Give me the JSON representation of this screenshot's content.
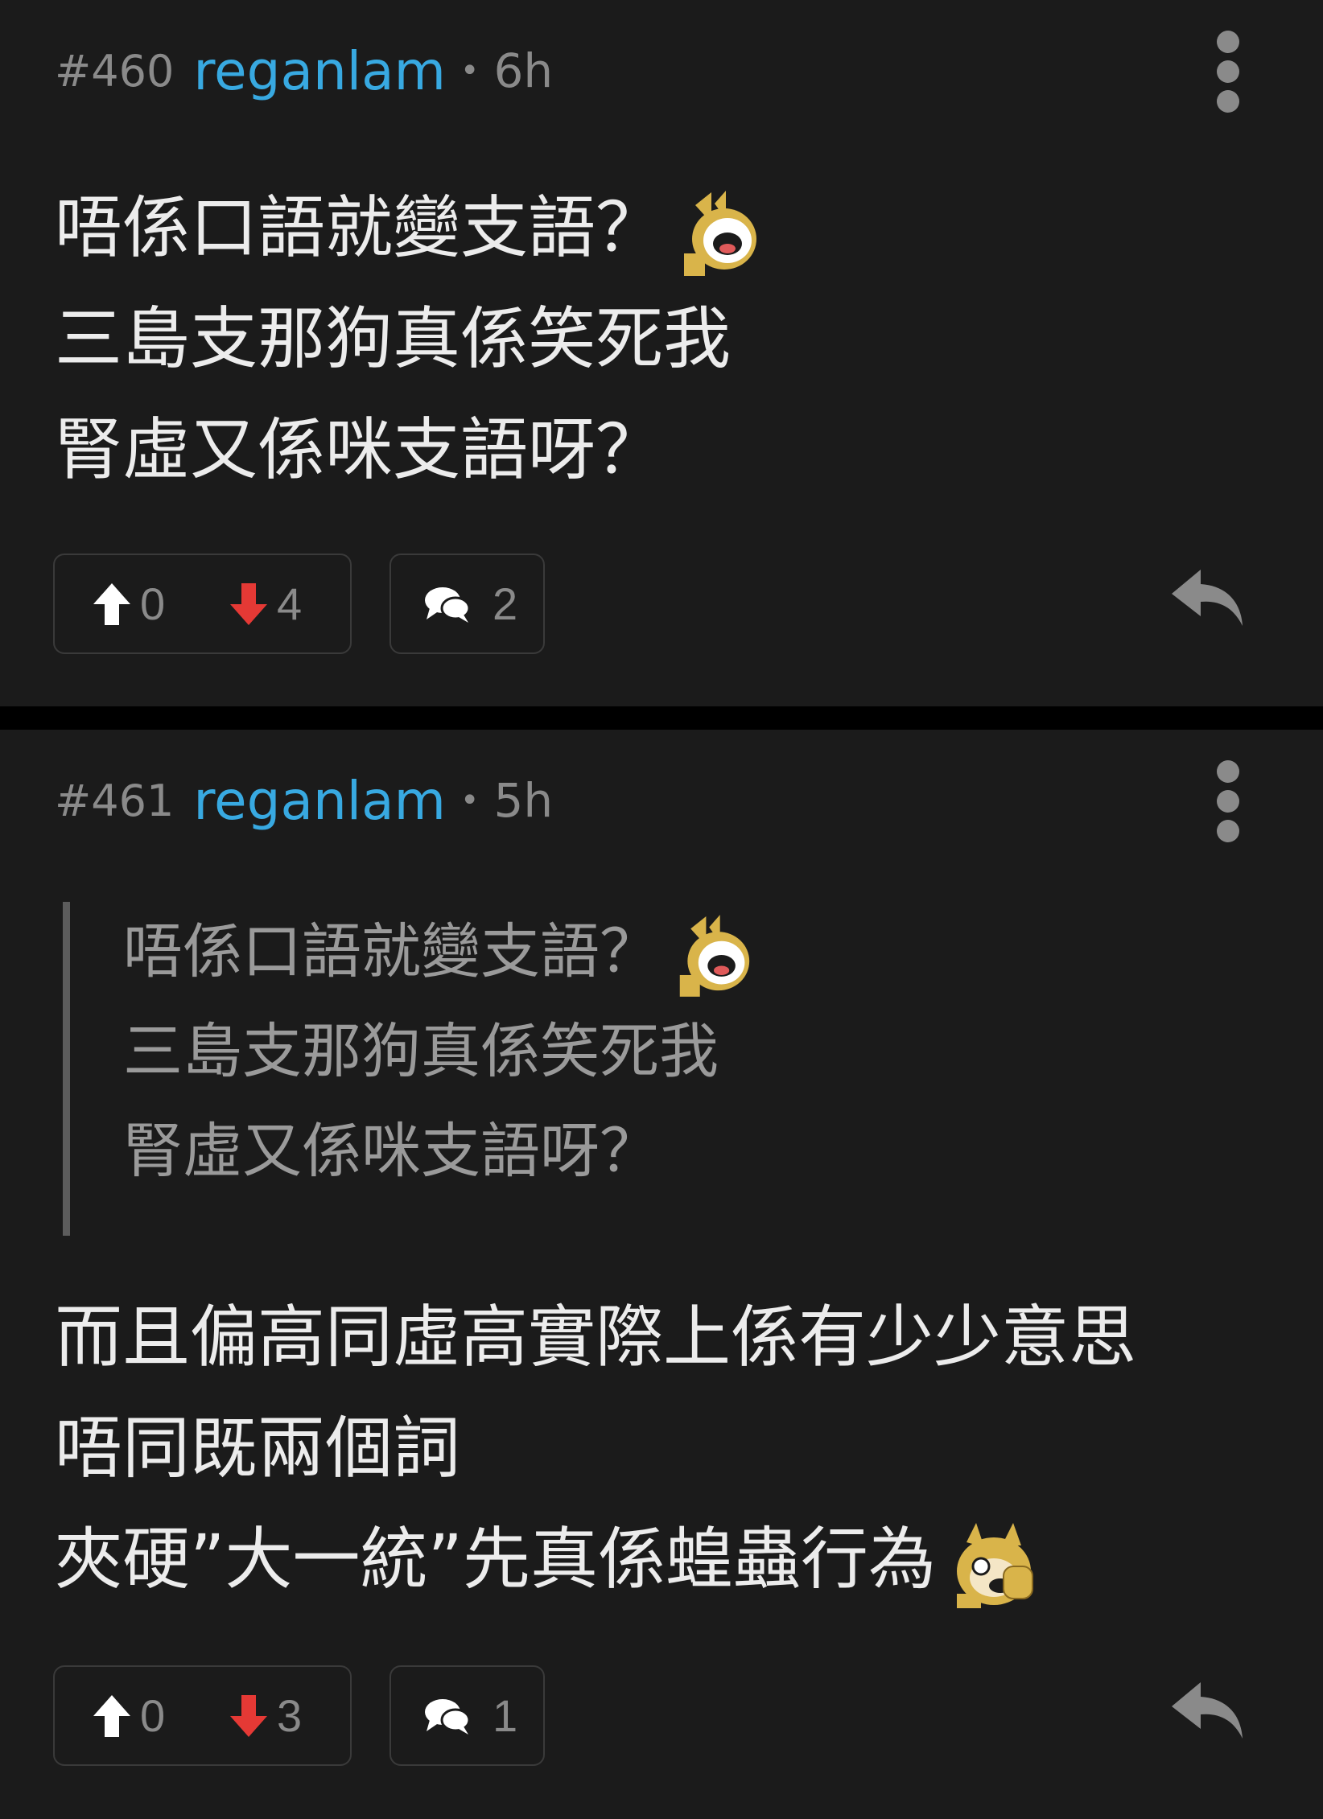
{
  "posts": [
    {
      "number": "#460",
      "username": "reganlam",
      "separator": "•",
      "time": "6h",
      "content_lines": [
        "唔係口語就變支語？",
        "三島支那狗真係笑死我",
        "腎虛又係咪支語呀？"
      ],
      "emoji_first_line": "laughing-dog-emoji",
      "votes": {
        "up": "0",
        "down": "4"
      },
      "comments": "2"
    },
    {
      "number": "#461",
      "username": "reganlam",
      "separator": "•",
      "time": "5h",
      "quote_lines": [
        "唔係口語就變支語？",
        "三島支那狗真係笑死我",
        "腎虛又係咪支語呀？"
      ],
      "emoji_quote_first_line": "laughing-dog-emoji",
      "content_lines": [
        "而且偏高同虛高實際上係有少少意思",
        "唔同既兩個詞",
        "夾硬”大一統”先真係蝗蟲行為"
      ],
      "emoji_last_line": "facepalm-dog-emoji",
      "votes": {
        "up": "0",
        "down": "3"
      },
      "comments": "1"
    }
  ],
  "colors": {
    "background": "#1b1b1b",
    "separator": "#000000",
    "username": "#38a9e1",
    "meta": "#8a8a8a",
    "text": "#ececec",
    "quote_text": "#9a9a9a",
    "quote_bar": "#5c5c5c",
    "upvote_icon": "#ffffff",
    "downvote_icon": "#e53935"
  }
}
